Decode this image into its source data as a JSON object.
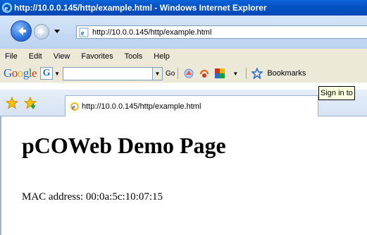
{
  "window": {
    "title": "http://10.0.0.145/http/example.html - Windows Internet Explorer"
  },
  "navigation": {
    "address": "http://10.0.0.145/http/example.html"
  },
  "menu": {
    "items": [
      "File",
      "Edit",
      "View",
      "Favorites",
      "Tools",
      "Help"
    ]
  },
  "google_toolbar": {
    "logo": "Google",
    "g_button": "G",
    "go_label": "Go",
    "bookmarks_label": "Bookmarks"
  },
  "tabs": {
    "active_title": "http://10.0.0.145/http/example.html",
    "tooltip": "Sign in to"
  },
  "page": {
    "heading": "pCOWeb Demo Page",
    "mac_address_line": "MAC address: 00:0a:5c:10:07:15"
  },
  "colors": {
    "titlebar": "#0553c6",
    "chrome": "#ece9d8",
    "google_blue": "#2a6ad3"
  },
  "icons": {
    "window_icon": "ie-icon",
    "back": "back-arrow-icon",
    "forward": "forward-arrow-icon",
    "favorites": "favorites-star-icon",
    "add_favorite": "add-favorite-icon",
    "page": "ie-page-icon"
  }
}
